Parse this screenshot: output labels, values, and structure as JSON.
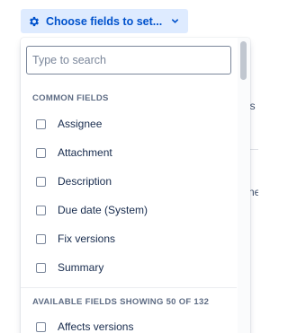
{
  "trigger": {
    "label": "Choose fields to set...",
    "icon": "gear-icon",
    "caret_icon": "chevron-down-icon",
    "accent_color": "#0052CC",
    "background_color": "#DEEBFF"
  },
  "search": {
    "placeholder": "Type to search",
    "value": ""
  },
  "common_fields": {
    "heading": "COMMON FIELDS",
    "items": [
      {
        "label": "Assignee",
        "checked": false
      },
      {
        "label": "Attachment",
        "checked": false
      },
      {
        "label": "Description",
        "checked": false
      },
      {
        "label": "Due date (System)",
        "checked": false
      },
      {
        "label": "Fix versions",
        "checked": false
      },
      {
        "label": "Summary",
        "checked": false
      }
    ]
  },
  "available_fields": {
    "heading": "AVAILABLE FIELDS SHOWING 50 OF 132",
    "items": [
      {
        "label": "Affects versions",
        "checked": false
      }
    ]
  },
  "background_fragments": {
    "right_a": "us",
    "right_b": "ne"
  }
}
